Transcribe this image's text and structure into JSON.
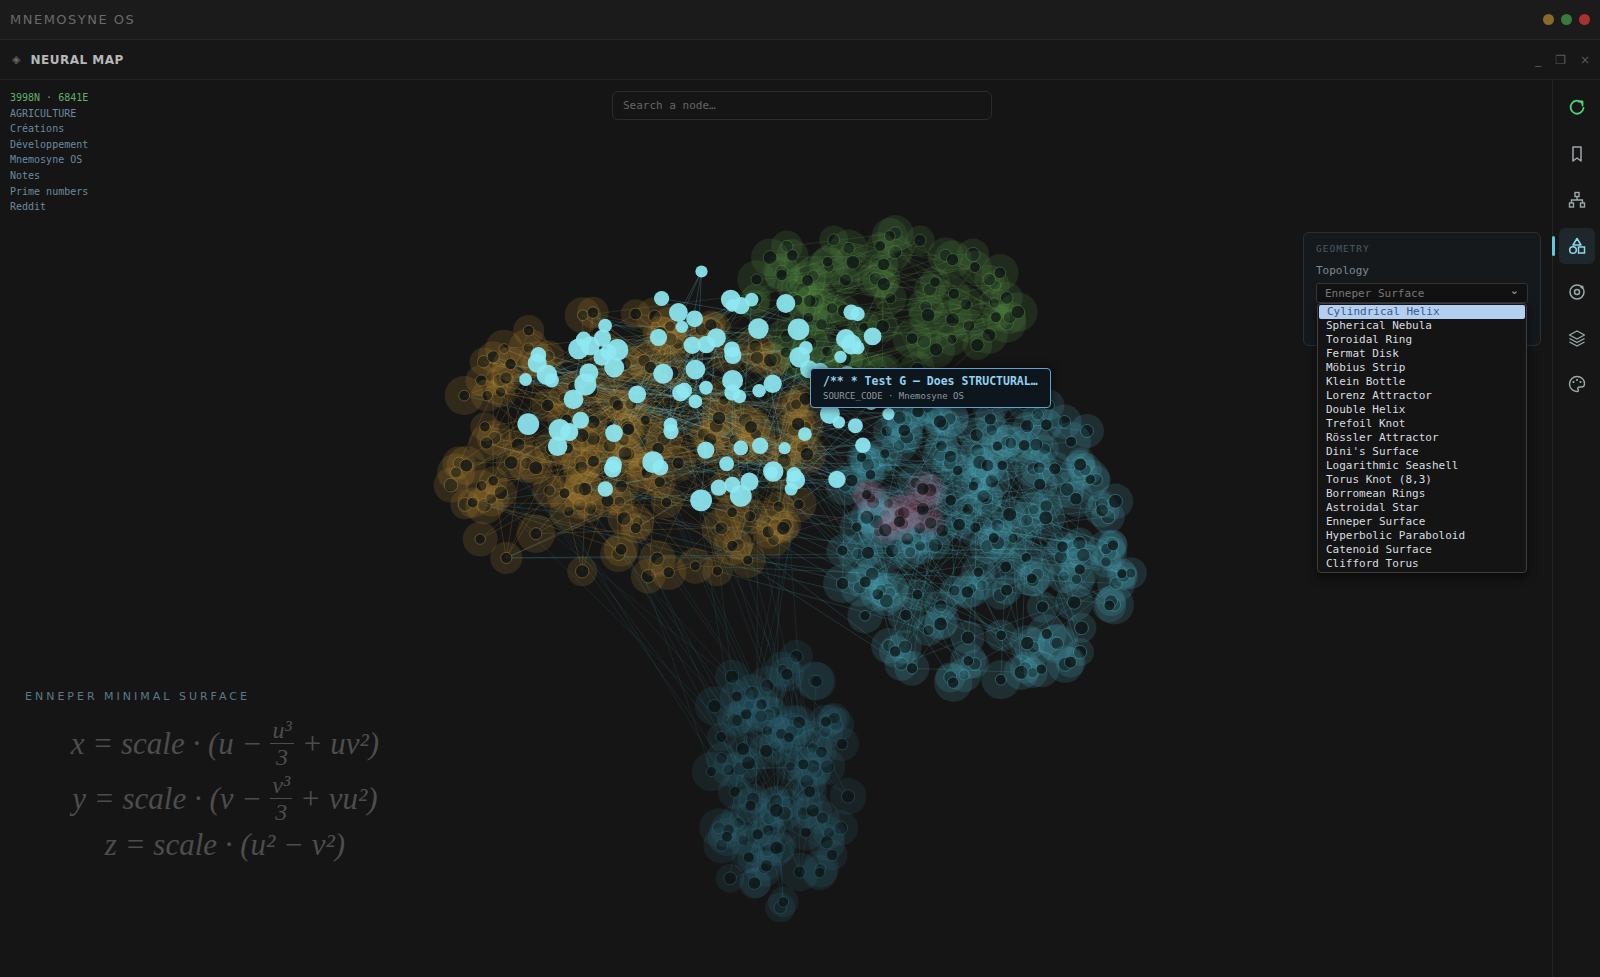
{
  "window": {
    "title": "MNEMOSYNE OS",
    "controls": [
      {
        "color": "#8a6a2a"
      },
      {
        "color": "#3a7a3a"
      },
      {
        "color": "#a83232"
      }
    ]
  },
  "panel": {
    "icon": "◈",
    "title": "NEURAL MAP",
    "controls": [
      "_",
      "❐",
      "×"
    ]
  },
  "stats": "3998N · 6841E",
  "legend": [
    "AGRICULTURE",
    "Créations",
    "Développement",
    "Mnemosyne OS",
    "Notes",
    "Prime numbers",
    "Reddit"
  ],
  "search": {
    "placeholder": "Search a node…"
  },
  "tooltip": {
    "title": "/** * Test G — Does STRUCTURAL…",
    "subtitle": "SOURCE_CODE · Mnemosyne OS"
  },
  "geometry": {
    "heading": "GEOMETRY",
    "label": "Topology",
    "value": "Enneper Surface",
    "chevron": "⌄",
    "options": [
      {
        "label": "Cylindrical Helix",
        "selected": true
      },
      {
        "label": "Spherical Nebula",
        "selected": false
      },
      {
        "label": "Toroidal Ring",
        "selected": false
      },
      {
        "label": "Fermat Disk",
        "selected": false
      },
      {
        "label": "Möbius Strip",
        "selected": false
      },
      {
        "label": "Klein Bottle",
        "selected": false
      },
      {
        "label": "Lorenz Attractor",
        "selected": false
      },
      {
        "label": "Double Helix",
        "selected": false
      },
      {
        "label": "Trefoil Knot",
        "selected": false
      },
      {
        "label": "Rössler Attractor",
        "selected": false
      },
      {
        "label": "Dini's Surface",
        "selected": false
      },
      {
        "label": "Logarithmic Seashell",
        "selected": false
      },
      {
        "label": "Torus Knot (8,3)",
        "selected": false
      },
      {
        "label": "Borromean Rings",
        "selected": false
      },
      {
        "label": "Astroidal Star",
        "selected": false
      },
      {
        "label": "Enneper Surface",
        "selected": false
      },
      {
        "label": "Hyperbolic Paraboloid",
        "selected": false
      },
      {
        "label": "Catenoid Surface",
        "selected": false
      },
      {
        "label": "Clifford Torus",
        "selected": false
      }
    ]
  },
  "rail": [
    {
      "kind": "refresh",
      "selected": false
    },
    {
      "kind": "bookmark",
      "selected": false
    },
    {
      "kind": "hierarchy",
      "selected": false
    },
    {
      "kind": "shapes",
      "selected": true
    },
    {
      "kind": "orbit",
      "selected": false
    },
    {
      "kind": "layers",
      "selected": false
    },
    {
      "kind": "palette",
      "selected": false
    }
  ],
  "formula": {
    "title": "ENNEPER MINIMAL SURFACE",
    "lines": [
      {
        "kind": "fraction",
        "before": "x = scale · (u −",
        "numerator": "u³",
        "denominator": "3",
        "after": "+ uv²)"
      },
      {
        "kind": "fraction",
        "before": "y = scale · (v −",
        "numerator": "v³",
        "denominator": "3",
        "after": "+ vu²)"
      },
      {
        "kind": "plain",
        "text": "z = scale · (u² − v²)"
      }
    ]
  },
  "graph": {
    "clusters": [
      {
        "kind": "halo",
        "color": "#c8963a",
        "nodes": 150
      },
      {
        "kind": "halo",
        "color": "#5e9a48",
        "nodes": 80
      },
      {
        "kind": "halo",
        "color": "#4fb4c4",
        "nodes": 190
      },
      {
        "kind": "halo",
        "color": "#2f7080",
        "nodes": 90
      },
      {
        "kind": "halo",
        "color": "#b06888",
        "nodes": 10
      },
      {
        "kind": "bright",
        "color": "#8ee8f2",
        "nodes": 95
      }
    ]
  }
}
